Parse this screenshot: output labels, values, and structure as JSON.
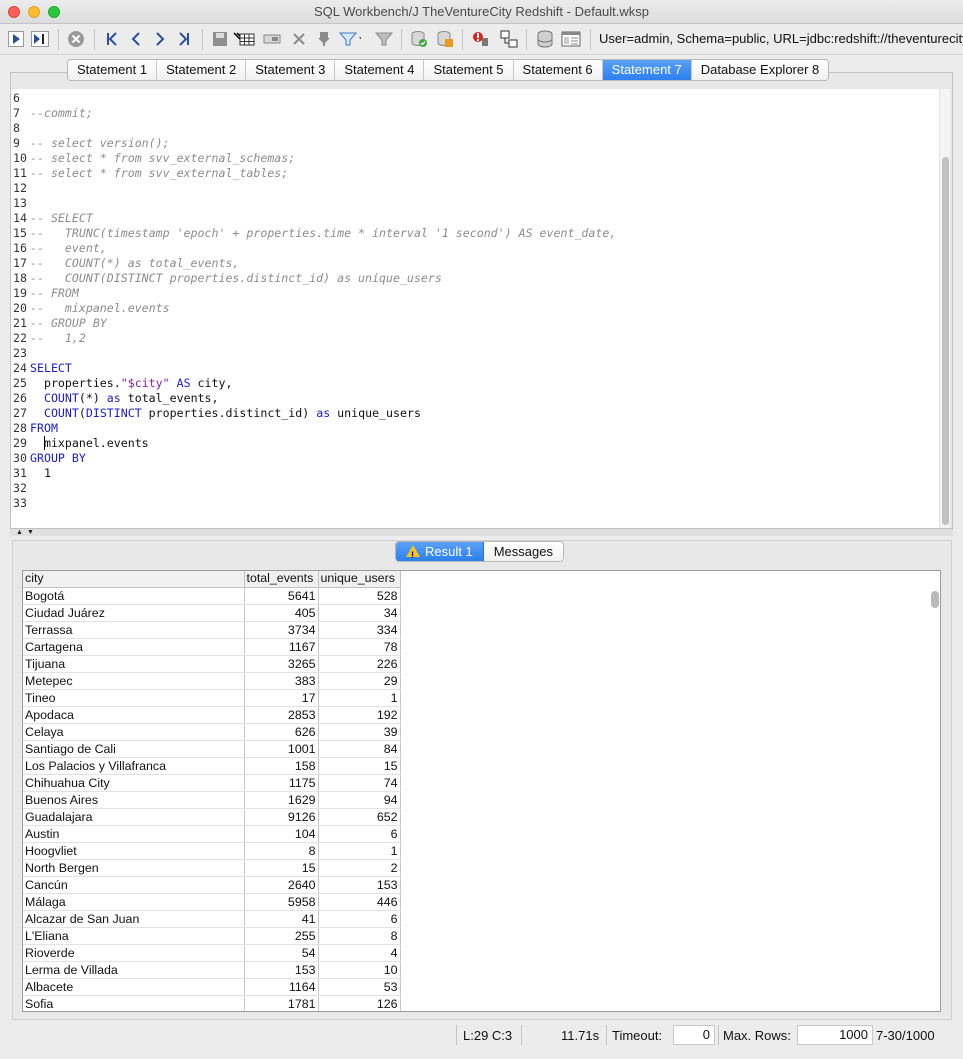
{
  "window": {
    "title": "SQL Workbench/J TheVentureCity Redshift - Default.wksp"
  },
  "toolbar": {
    "connection_info": "User=admin, Schema=public, URL=jdbc:redshift://theventurecity",
    "icons": [
      "execute-icon",
      "execute-current-icon",
      "cancel-icon",
      "first-icon",
      "previous-icon",
      "next-icon",
      "last-icon",
      "save-icon",
      "grid-icon",
      "copy-icon",
      "delete-icon",
      "pin-icon",
      "filter-icon",
      "clear-filter-icon",
      "commit-icon",
      "rollback-icon",
      "database-icon",
      "explorer-icon"
    ]
  },
  "tabs": [
    {
      "label": "Statement 1",
      "active": false
    },
    {
      "label": "Statement 2",
      "active": false
    },
    {
      "label": "Statement 3",
      "active": false
    },
    {
      "label": "Statement 4",
      "active": false
    },
    {
      "label": "Statement 5",
      "active": false
    },
    {
      "label": "Statement 6",
      "active": false
    },
    {
      "label": "Statement 7",
      "active": true
    },
    {
      "label": "Database Explorer 8",
      "active": false
    }
  ],
  "editor": {
    "lines": [
      {
        "n": "6",
        "text": ""
      },
      {
        "n": "7",
        "text": "--commit;"
      },
      {
        "n": "8",
        "text": ""
      },
      {
        "n": "9",
        "text": "-- select version();"
      },
      {
        "n": "10",
        "text": "-- select * from svv_external_schemas;"
      },
      {
        "n": "11",
        "text": "-- select * from svv_external_tables;"
      },
      {
        "n": "12",
        "text": ""
      },
      {
        "n": "13",
        "text": ""
      },
      {
        "n": "14",
        "text": "-- SELECT"
      },
      {
        "n": "15",
        "text": "--   TRUNC(timestamp 'epoch' + properties.time * interval '1 second') AS event_date,"
      },
      {
        "n": "16",
        "text": "--   event,"
      },
      {
        "n": "17",
        "text": "--   COUNT(*) as total_events,"
      },
      {
        "n": "18",
        "text": "--   COUNT(DISTINCT properties.distinct_id) as unique_users"
      },
      {
        "n": "19",
        "text": "-- FROM"
      },
      {
        "n": "20",
        "text": "--   mixpanel.events"
      },
      {
        "n": "21",
        "text": "-- GROUP BY"
      },
      {
        "n": "22",
        "text": "--   1,2"
      },
      {
        "n": "23",
        "text": ""
      },
      {
        "n": "24",
        "text": "SELECT"
      },
      {
        "n": "25",
        "text": "  properties.\"$city\" AS city,"
      },
      {
        "n": "26",
        "text": "  COUNT(*) as total_events,"
      },
      {
        "n": "27",
        "text": "  COUNT(DISTINCT properties.distinct_id) as unique_users"
      },
      {
        "n": "28",
        "text": "FROM"
      },
      {
        "n": "29",
        "text": "  mixpanel.events"
      },
      {
        "n": "30",
        "text": "GROUP BY"
      },
      {
        "n": "31",
        "text": "  1"
      },
      {
        "n": "32",
        "text": ""
      },
      {
        "n": "33",
        "text": ""
      }
    ]
  },
  "result_tabs": {
    "result": "Result 1",
    "messages": "Messages"
  },
  "result": {
    "columns": [
      "city",
      "total_events",
      "unique_users"
    ],
    "rows": [
      [
        "Bogotá",
        "5641",
        "528"
      ],
      [
        "Ciudad Juárez",
        "405",
        "34"
      ],
      [
        "Terrassa",
        "3734",
        "334"
      ],
      [
        "Cartagena",
        "1167",
        "78"
      ],
      [
        "Tijuana",
        "3265",
        "226"
      ],
      [
        "Metepec",
        "383",
        "29"
      ],
      [
        "Tineo",
        "17",
        "1"
      ],
      [
        "Apodaca",
        "2853",
        "192"
      ],
      [
        "Celaya",
        "626",
        "39"
      ],
      [
        "Santiago de Cali",
        "1001",
        "84"
      ],
      [
        "Los Palacios y Villafranca",
        "158",
        "15"
      ],
      [
        "Chihuahua City",
        "1175",
        "74"
      ],
      [
        "Buenos Aires",
        "1629",
        "94"
      ],
      [
        "Guadalajara",
        "9126",
        "652"
      ],
      [
        "Austin",
        "104",
        "6"
      ],
      [
        "Hoogvliet",
        "8",
        "1"
      ],
      [
        "North Bergen",
        "15",
        "2"
      ],
      [
        "Cancún",
        "2640",
        "153"
      ],
      [
        "Málaga",
        "5958",
        "446"
      ],
      [
        "Alcazar de San Juan",
        "41",
        "6"
      ],
      [
        "L'Eliana",
        "255",
        "8"
      ],
      [
        "Rioverde",
        "54",
        "4"
      ],
      [
        "Lerma de Villada",
        "153",
        "10"
      ],
      [
        "Albacete",
        "1164",
        "53"
      ],
      [
        "Sofia",
        "1781",
        "126"
      ]
    ]
  },
  "status": {
    "cursor": "L:29 C:3",
    "exec_time": "11.71s",
    "timeout_label": "Timeout:",
    "timeout_value": "0",
    "maxrows_label": "Max. Rows:",
    "maxrows_value": "1000",
    "range": "7-30/1000"
  }
}
